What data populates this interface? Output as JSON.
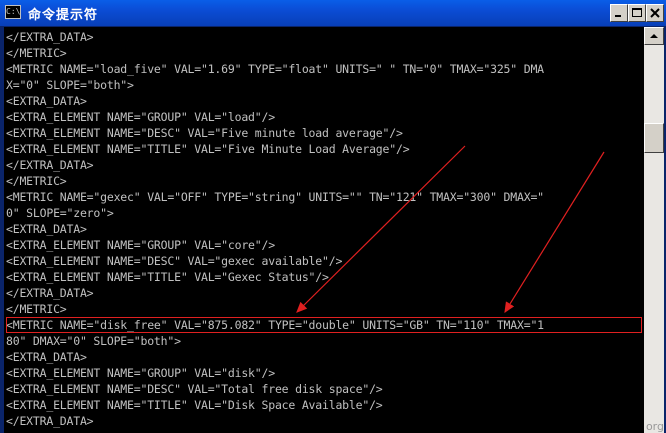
{
  "window": {
    "title": "命令提示符",
    "icon_text": "C:\\",
    "icon": "console-icon",
    "controls": [
      "minimize-icon",
      "maximize-icon",
      "close-icon"
    ]
  },
  "console": {
    "lines": [
      "</EXTRA_DATA>",
      "</METRIC>",
      "<METRIC NAME=\"load_five\" VAL=\"1.69\" TYPE=\"float\" UNITS=\" \" TN=\"0\" TMAX=\"325\" DMA",
      "X=\"0\" SLOPE=\"both\">",
      "<EXTRA_DATA>",
      "<EXTRA_ELEMENT NAME=\"GROUP\" VAL=\"load\"/>",
      "<EXTRA_ELEMENT NAME=\"DESC\" VAL=\"Five minute load average\"/>",
      "<EXTRA_ELEMENT NAME=\"TITLE\" VAL=\"Five Minute Load Average\"/>",
      "</EXTRA_DATA>",
      "</METRIC>",
      "<METRIC NAME=\"gexec\" VAL=\"OFF\" TYPE=\"string\" UNITS=\"\" TN=\"121\" TMAX=\"300\" DMAX=\"",
      "0\" SLOPE=\"zero\">",
      "<EXTRA_DATA>",
      "<EXTRA_ELEMENT NAME=\"GROUP\" VAL=\"core\"/>",
      "<EXTRA_ELEMENT NAME=\"DESC\" VAL=\"gexec available\"/>",
      "<EXTRA_ELEMENT NAME=\"TITLE\" VAL=\"Gexec Status\"/>",
      "</EXTRA_DATA>",
      "</METRIC>",
      "<METRIC NAME=\"disk_free\" VAL=\"875.082\" TYPE=\"double\" UNITS=\"GB\" TN=\"110\" TMAX=\"1",
      "80\" DMAX=\"0\" SLOPE=\"both\">",
      "<EXTRA_DATA>",
      "<EXTRA_ELEMENT NAME=\"GROUP\" VAL=\"disk\"/>",
      "<EXTRA_ELEMENT NAME=\"DESC\" VAL=\"Total free disk space\"/>",
      "<EXTRA_ELEMENT NAME=\"TITLE\" VAL=\"Disk Space Available\"/>",
      "</EXTRA_DATA>"
    ],
    "highlighted_line": 18,
    "text_color": "#c0c0c0",
    "background": "#000000",
    "highlight_color": "#e02020"
  },
  "annotations": {
    "arrow_color": "#e02020"
  },
  "watermark": "org"
}
